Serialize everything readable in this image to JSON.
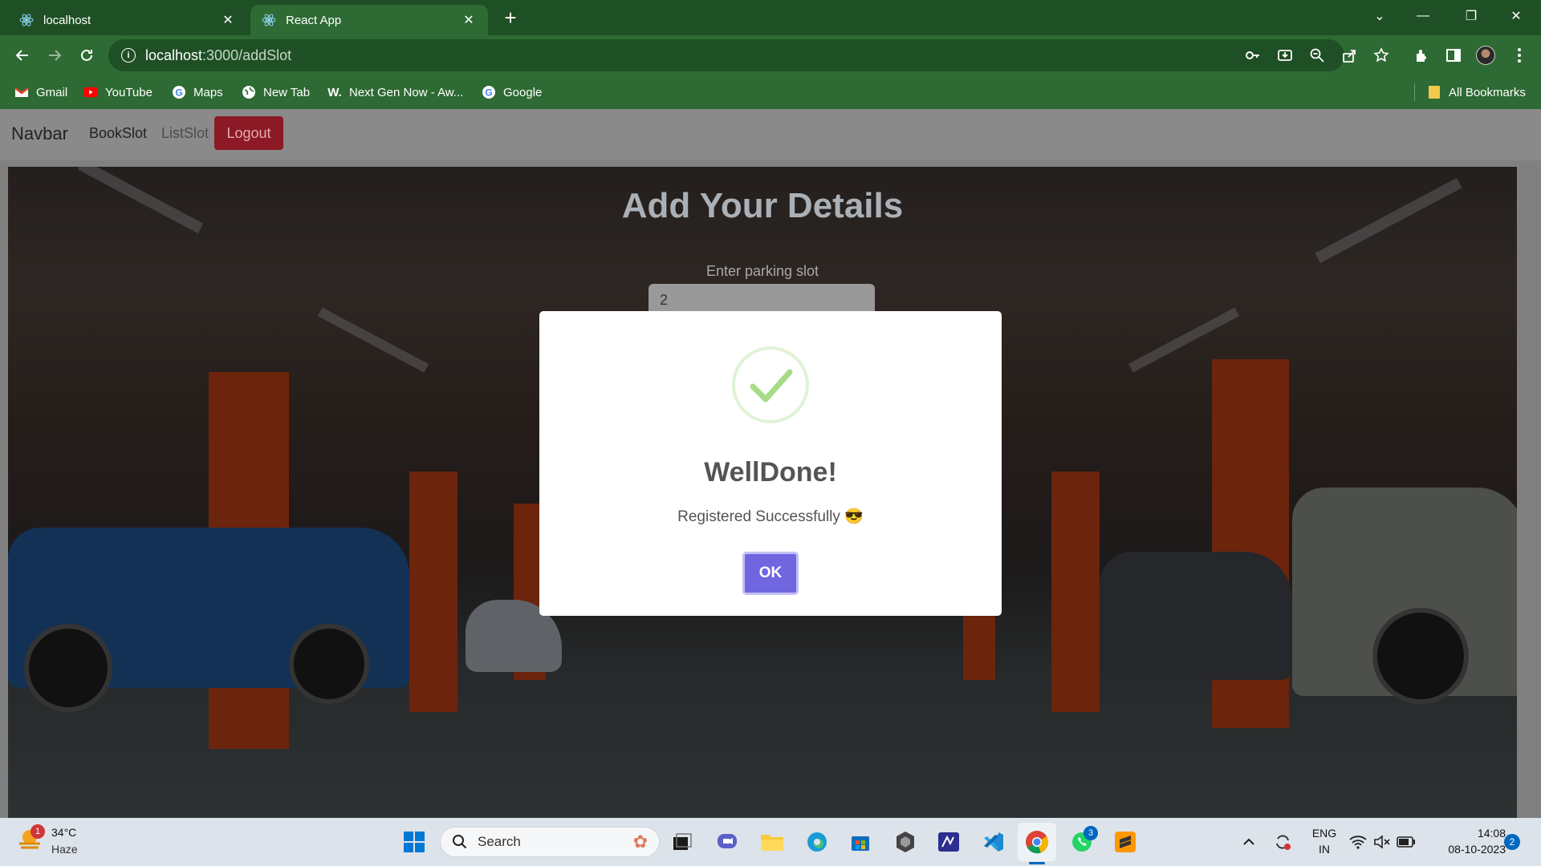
{
  "browser": {
    "tabs": [
      {
        "label": "localhost",
        "active": false
      },
      {
        "label": "React App",
        "active": true
      }
    ],
    "url_host": "localhost",
    "url_path": ":3000/addSlot",
    "bookmarks": [
      {
        "label": "Gmail",
        "icon": "gmail-icon"
      },
      {
        "label": "YouTube",
        "icon": "youtube-icon"
      },
      {
        "label": "Maps",
        "icon": "google-icon"
      },
      {
        "label": "New Tab",
        "icon": "globe-icon"
      },
      {
        "label": "Next Gen Now - Aw...",
        "icon": "w-icon"
      },
      {
        "label": "Google",
        "icon": "google-icon"
      }
    ],
    "all_bookmarks": "All Bookmarks"
  },
  "app": {
    "brand": "Navbar",
    "links": [
      {
        "label": "BookSlot"
      },
      {
        "label": "ListSlot"
      }
    ],
    "logout": "Logout",
    "heading": "Add Your Details",
    "slot_label": "Enter parking slot",
    "slot_value": "2"
  },
  "modal": {
    "title": "WellDone!",
    "text": "Registered Successfully 😎",
    "ok": "OK"
  },
  "taskbar": {
    "weather_temp": "34°C",
    "weather_cond": "Haze",
    "weather_badge": "1",
    "search_placeholder": "Search",
    "whatsapp_badge": "3",
    "lang_line1": "ENG",
    "lang_line2": "IN",
    "time": "14:08",
    "date": "08-10-2023",
    "notif_count": "2"
  },
  "colors": {
    "chrome_dark": "#1f4f24",
    "chrome": "#2e6a33",
    "logout_bg": "#8b1a26",
    "ok_button": "#7066e0",
    "success_green": "#a5dc86"
  }
}
